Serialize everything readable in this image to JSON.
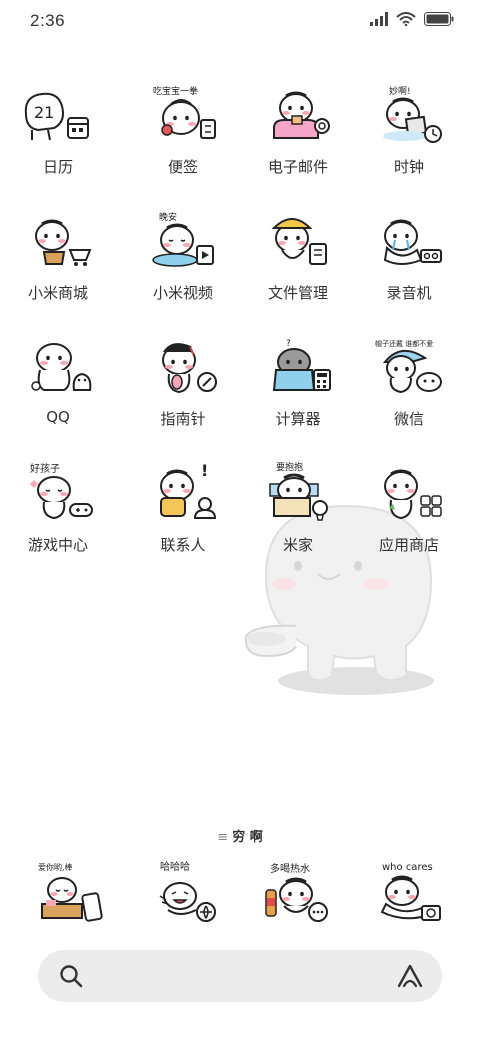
{
  "status_bar": {
    "time": "2:36"
  },
  "apps": [
    {
      "label": "日历",
      "icon": "calendar-mascot",
      "caption": "",
      "calendar_day": "21"
    },
    {
      "label": "便签",
      "icon": "notes-mascot",
      "caption": "吃宝宝一拳"
    },
    {
      "label": "电子邮件",
      "icon": "email-mascot",
      "caption": ""
    },
    {
      "label": "时钟",
      "icon": "clock-mascot",
      "caption": "妙啊!"
    },
    {
      "label": "小米商城",
      "icon": "shop-mascot",
      "caption": ""
    },
    {
      "label": "小米视频",
      "icon": "video-mascot",
      "caption": "晚安"
    },
    {
      "label": "文件管理",
      "icon": "files-mascot",
      "caption": ""
    },
    {
      "label": "录音机",
      "icon": "recorder-mascot",
      "caption": ""
    },
    {
      "label": "QQ",
      "icon": "qq-mascot",
      "caption": ""
    },
    {
      "label": "指南针",
      "icon": "compass-mascot",
      "caption": ""
    },
    {
      "label": "计算器",
      "icon": "calculator-mascot",
      "caption": "?"
    },
    {
      "label": "微信",
      "icon": "wechat-mascot",
      "caption": "帽子还戴 谁都不爱"
    },
    {
      "label": "游戏中心",
      "icon": "game-mascot",
      "caption": "好孩子"
    },
    {
      "label": "联系人",
      "icon": "contacts-mascot",
      "caption": "!"
    },
    {
      "label": "米家",
      "icon": "mihome-mascot",
      "caption": "要抱抱"
    },
    {
      "label": "应用商店",
      "icon": "appstore-mascot",
      "caption": ""
    }
  ],
  "dock": {
    "title": "穷 啊",
    "apps": [
      {
        "icon": "phone-mascot",
        "caption": "爱你哟,棒"
      },
      {
        "icon": "browser-mascot",
        "caption": "哈哈哈"
      },
      {
        "icon": "messages-mascot",
        "caption": "多喝热水"
      },
      {
        "icon": "camera-mascot",
        "caption": "who cares"
      }
    ]
  },
  "colors": {
    "background": "#ffffff",
    "search_bg": "#ececec",
    "mascot_blush": "#f7a8b2"
  }
}
